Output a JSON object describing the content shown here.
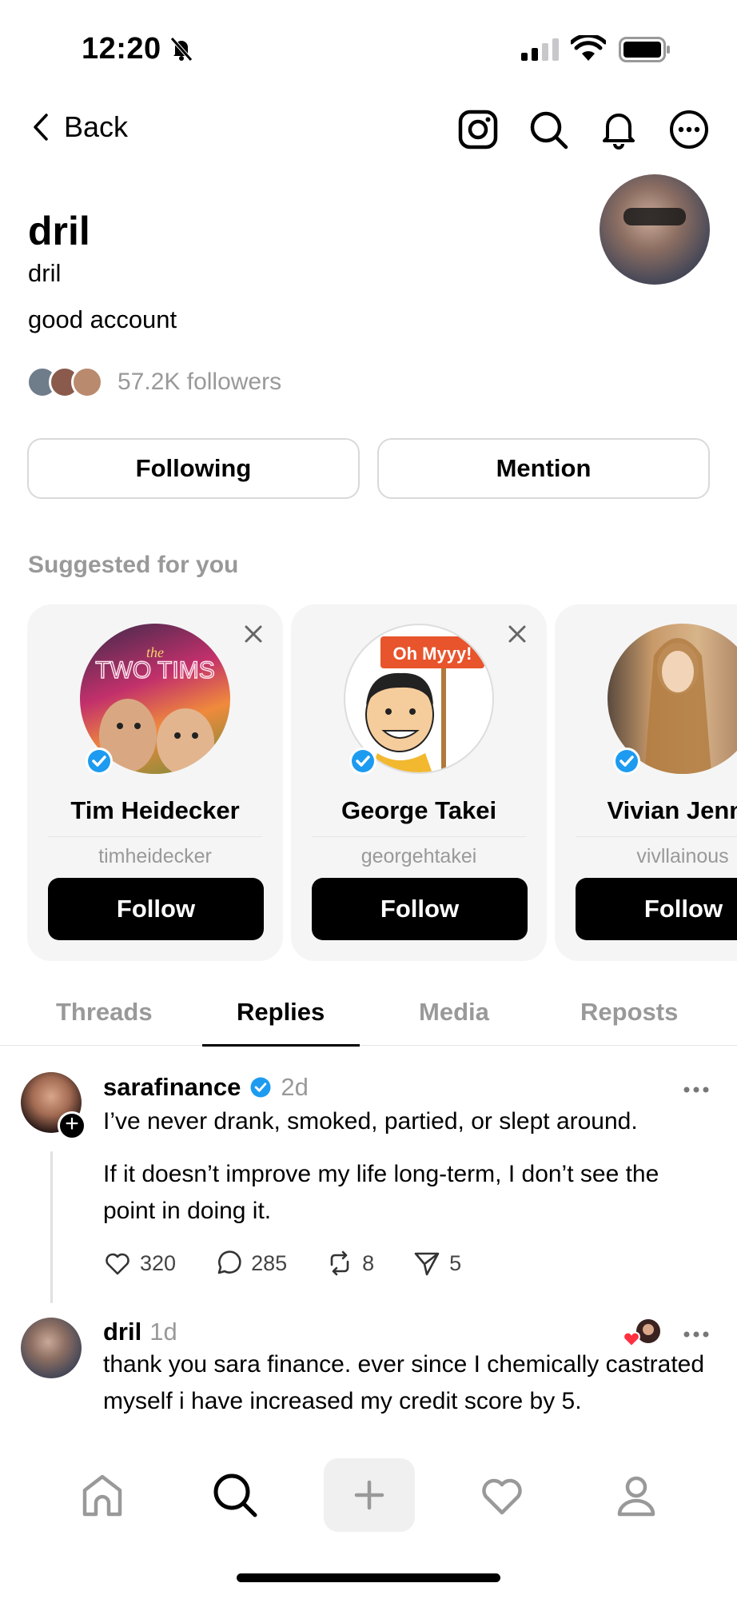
{
  "status_bar": {
    "time": "12:20"
  },
  "nav": {
    "back_label": "Back"
  },
  "profile": {
    "name": "dril",
    "handle": "dril",
    "bio": "good account",
    "followers": "57.2K followers",
    "following_label": "Following",
    "mention_label": "Mention"
  },
  "suggested": {
    "title": "Suggested for you",
    "cards": [
      {
        "name": "Tim Heidecker",
        "handle": "timheidecker",
        "follow_label": "Follow",
        "verified": true,
        "pic_text": "TWO TIMS"
      },
      {
        "name": "George Takei",
        "handle": "georgehtakei",
        "follow_label": "Follow",
        "verified": true,
        "pic_text": "Oh Myyy!"
      },
      {
        "name": "Vivian Jenna",
        "handle": "vivllainous",
        "follow_label": "Follow",
        "verified": true
      }
    ]
  },
  "tabs": [
    "Threads",
    "Replies",
    "Media",
    "Reposts"
  ],
  "active_tab": "Replies",
  "posts": [
    {
      "user": "sarafinance",
      "verified": true,
      "time": "2d",
      "text1": "I’ve never drank, smoked, partied, or slept around.",
      "text2": "If it doesn’t improve my life long-term, I don’t see the point in doing it.",
      "likes": "320",
      "comments": "285",
      "reposts": "8",
      "shares": "5"
    },
    {
      "user": "dril",
      "time": "1d",
      "text": "thank you sara finance. ever since I chemically castrated myself i have increased my credit score by 5."
    }
  ],
  "colors": {
    "verified": "#1d9bf0",
    "like_heart": "#ff3040",
    "muted": "#999999"
  },
  "icons": {
    "status": [
      "bell-slash-icon",
      "signal-icon",
      "wifi-icon",
      "battery-icon"
    ],
    "nav": [
      "chevron-left-icon",
      "instagram-icon",
      "search-icon",
      "bell-icon",
      "more-icon"
    ],
    "bottom": [
      "home-icon",
      "search-icon",
      "plus-icon",
      "heart-icon",
      "profile-icon"
    ]
  }
}
